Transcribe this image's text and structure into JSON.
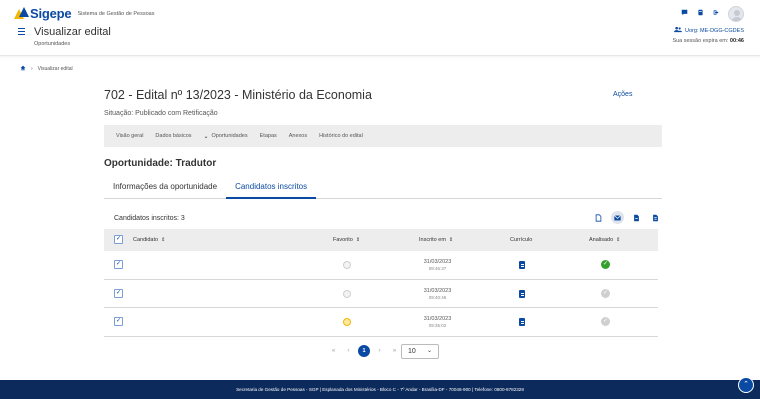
{
  "header": {
    "logo_text": "Sigepe",
    "logo_subtitle": "Sistema de Gestão de Pessoas",
    "page_title": "Visualizar edital",
    "page_subtitle": "Oportunidades",
    "uorg_label": "Uorg: ME-DGG-CGDES",
    "session_label": "Sua sessão expira em:",
    "session_time": "00:46"
  },
  "breadcrumb": {
    "current": "Visualizar edital"
  },
  "main": {
    "title": "702 - Edital nº 13/2023 - Ministério da Economia",
    "actions_label": "Ações",
    "situacao": "Situação: Publicado com Retificação",
    "subnav": [
      "Visão geral",
      "Dados básicos",
      "Oportunidades",
      "Etapas",
      "Anexos",
      "Histórico do edital"
    ],
    "opportunity_title": "Oportunidade: Tradutor",
    "tabs": [
      "Informações da oportunidade",
      "Candidatos inscritos"
    ],
    "count_label": "Candidatos inscritos: 3"
  },
  "table": {
    "headers": {
      "candidato": "Candidato",
      "favorito": "Favorito",
      "inscrito_em": "Inscrito em",
      "curriculo": "Currículo",
      "analisado": "Analisado"
    },
    "rows": [
      {
        "date": "31/03/2023",
        "time": "08:46:37",
        "favorite": false,
        "analisado": true
      },
      {
        "date": "31/03/2023",
        "time": "09:40:46",
        "favorite": false,
        "analisado": false
      },
      {
        "date": "31/03/2023",
        "time": "09:35:02",
        "favorite": true,
        "analisado": false
      }
    ]
  },
  "pagination": {
    "first": "«",
    "prev": "‹",
    "current": "1",
    "next": "›",
    "last": "»",
    "page_size": "10"
  },
  "footer": {
    "text": "Secretaria de Gestão de Pessoas - SGP | Esplanada dos Ministérios - Bloco C - 7º Andar - Brasília-DF - 70046-900 | Telefone: 0800-9782328"
  },
  "colors": {
    "brand_blue": "#0b4aa2",
    "footer_navy": "#0c2a5b",
    "favorite_yellow": "#f2b705",
    "analyzed_green": "#33a02c"
  }
}
